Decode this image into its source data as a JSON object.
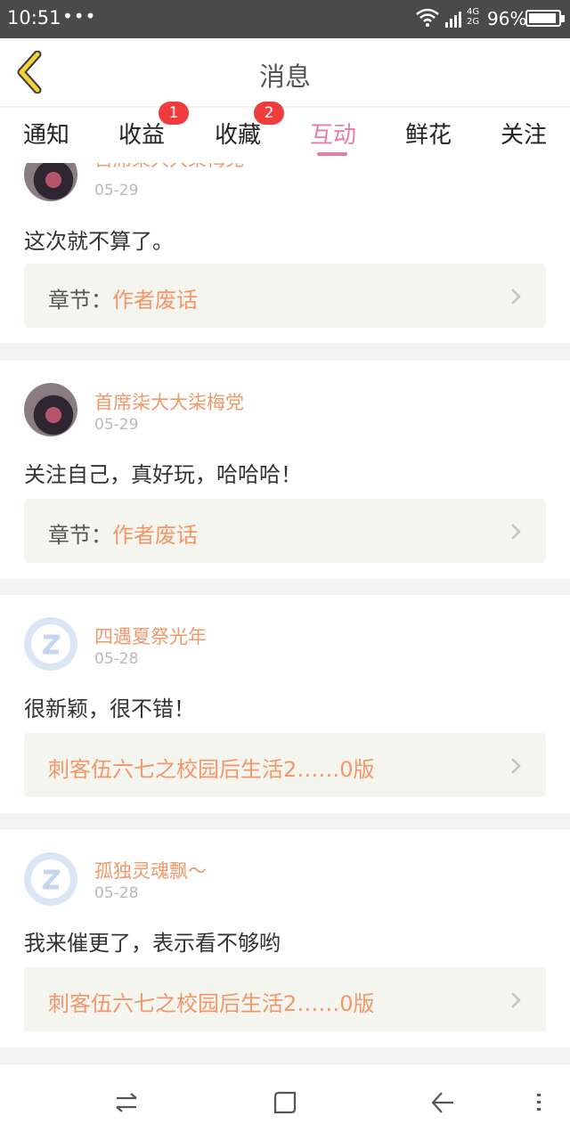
{
  "statusbar": {
    "time": "10:51",
    "dots": "•••",
    "net_top": "4G",
    "net_bottom": "2G",
    "battery": "96%"
  },
  "header": {
    "title": "消息"
  },
  "tabs": [
    {
      "label": "通知"
    },
    {
      "label": "收益",
      "badge": "1"
    },
    {
      "label": "收藏",
      "badge": "2"
    },
    {
      "label": "互动",
      "active": true
    },
    {
      "label": "鲜花"
    },
    {
      "label": "关注"
    }
  ],
  "feed": [
    {
      "user": "首席柒大大柒梅党",
      "date": "05-29",
      "text": "这次就不算了。",
      "chapter_prefix": "章节：",
      "chapter": "作者废话"
    },
    {
      "user": "首席柒大大柒梅党",
      "date": "05-29",
      "text": "关注自己，真好玩，哈哈哈！",
      "chapter_prefix": "章节：",
      "chapter": "作者废话"
    },
    {
      "user": "四遇夏祭光年",
      "date": "05-28",
      "text": "很新颖，很不错！",
      "chapter_prefix": "",
      "chapter": "刺客伍六七之校园后生活2……0版"
    },
    {
      "user": "孤独灵魂飘～",
      "date": "05-28",
      "text": "我来催更了，表示看不够哟",
      "chapter_prefix": "",
      "chapter": "刺客伍六七之校园后生活2……0版"
    }
  ],
  "icons": {
    "back": "back-chevron-icon",
    "chevron": "chevron-right-icon",
    "nav": [
      "switch-icon",
      "square-icon",
      "back-arrow-icon",
      "menu-icon"
    ]
  },
  "colors": {
    "accent": "#e97ba4",
    "username": "#f0986a",
    "badge": "#f03c3c"
  }
}
